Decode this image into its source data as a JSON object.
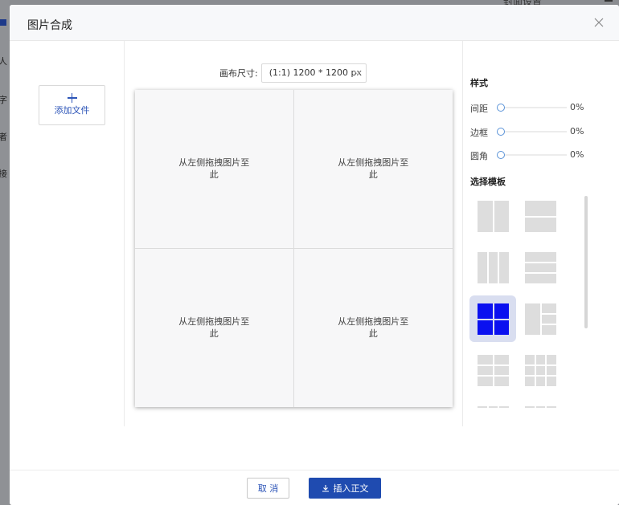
{
  "background": {
    "side_chars": [
      "人",
      "字",
      "者",
      "接"
    ],
    "top_text": "封面设置"
  },
  "dialog": {
    "title": "图片合成",
    "close_icon": "close-icon"
  },
  "left": {
    "add_file_label": "添加文件",
    "add_icon": "plus-icon"
  },
  "canvas": {
    "size_label": "画布尺寸:",
    "size_value": "(1:1) 1200 * 1200 px",
    "cells": [
      "从左侧拖拽图片至此",
      "从左侧拖拽图片至此",
      "从左侧拖拽图片至此",
      "从左侧拖拽图片至此"
    ]
  },
  "style_panel": {
    "title": "样式",
    "sliders": [
      {
        "label": "间距",
        "value": "0%"
      },
      {
        "label": "边框",
        "value": "0%"
      },
      {
        "label": "圆角",
        "value": "0%"
      }
    ],
    "template_title": "选择模板",
    "selected_template": "2x2-grid",
    "selected_color": "#0a10f0"
  },
  "footer": {
    "cancel_label": "取 消",
    "insert_label": "插入正文",
    "insert_icon": "download-icon"
  },
  "colors": {
    "primary": "#1f4bb0",
    "link": "#2d55b8"
  }
}
